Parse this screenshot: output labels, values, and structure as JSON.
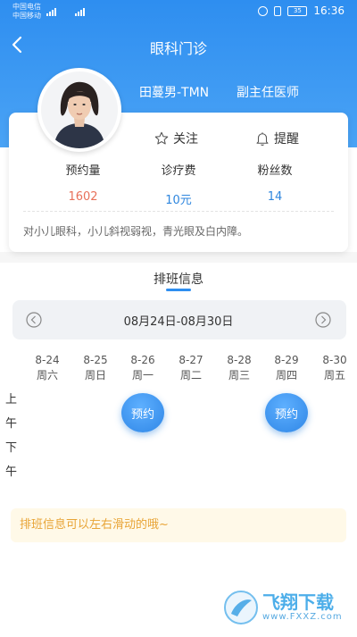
{
  "status_bar": {
    "carrier1": "中国电信",
    "carrier2": "中国移动",
    "battery": "35",
    "time": "16:36"
  },
  "nav": {
    "title": "眼科门诊",
    "back_icon": "chevron-left-icon"
  },
  "doctor": {
    "name": "田蔓男-TMN",
    "title": "副主任医师",
    "follow_label": "关注",
    "remind_label": "提醒",
    "stats": [
      {
        "label": "预约量",
        "value": "1602"
      },
      {
        "label": "诊疗费",
        "value": "10元"
      },
      {
        "label": "粉丝数",
        "value": "14"
      }
    ],
    "specialty": "对小儿眼科，小儿斜视弱视，青光眼及白内障。"
  },
  "schedule": {
    "title": "排班信息",
    "week_range": "08月24日-08月30日",
    "days": [
      {
        "date": "8-24",
        "weekday": "周六"
      },
      {
        "date": "8-25",
        "weekday": "周日"
      },
      {
        "date": "8-26",
        "weekday": "周一"
      },
      {
        "date": "8-27",
        "weekday": "周二"
      },
      {
        "date": "8-28",
        "weekday": "周三"
      },
      {
        "date": "8-29",
        "weekday": "周四"
      },
      {
        "date": "8-30",
        "weekday": "周五"
      }
    ],
    "am_label": "上午",
    "pm_label": "下午",
    "book_label": "预约",
    "tip": "排班信息可以左右滑动的哦~"
  },
  "watermark": {
    "main": "飞翔下载",
    "sub": "www.FXXZ.com"
  },
  "colors": {
    "primary": "#2e8ef0",
    "count_red": "#e8715a",
    "tip_text": "#e8a436",
    "tip_bg": "#fff9e8"
  }
}
